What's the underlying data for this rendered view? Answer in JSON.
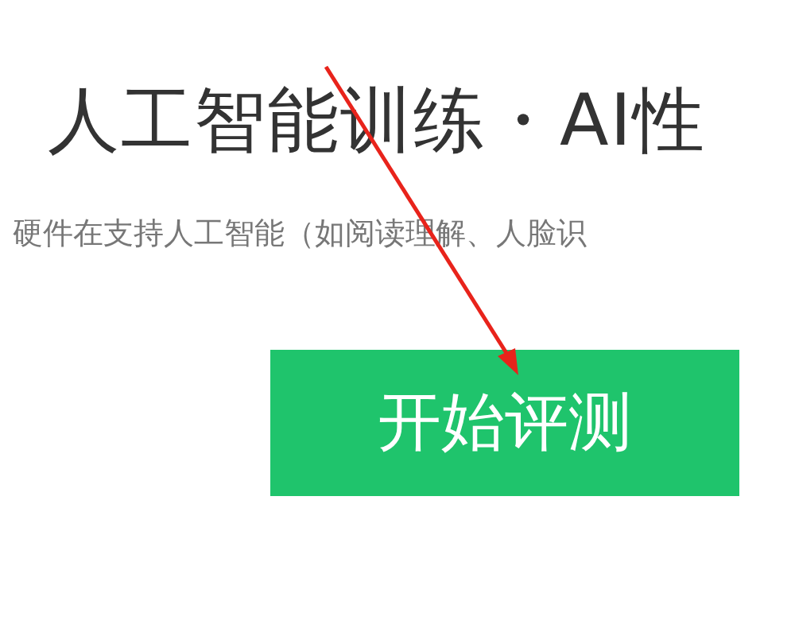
{
  "title": "人工智能训练・AI性",
  "subtitle": "硬件在支持人工智能（如阅读理解、人脸识",
  "start_button": "开始评测",
  "annotation": {
    "kind": "arrow"
  }
}
